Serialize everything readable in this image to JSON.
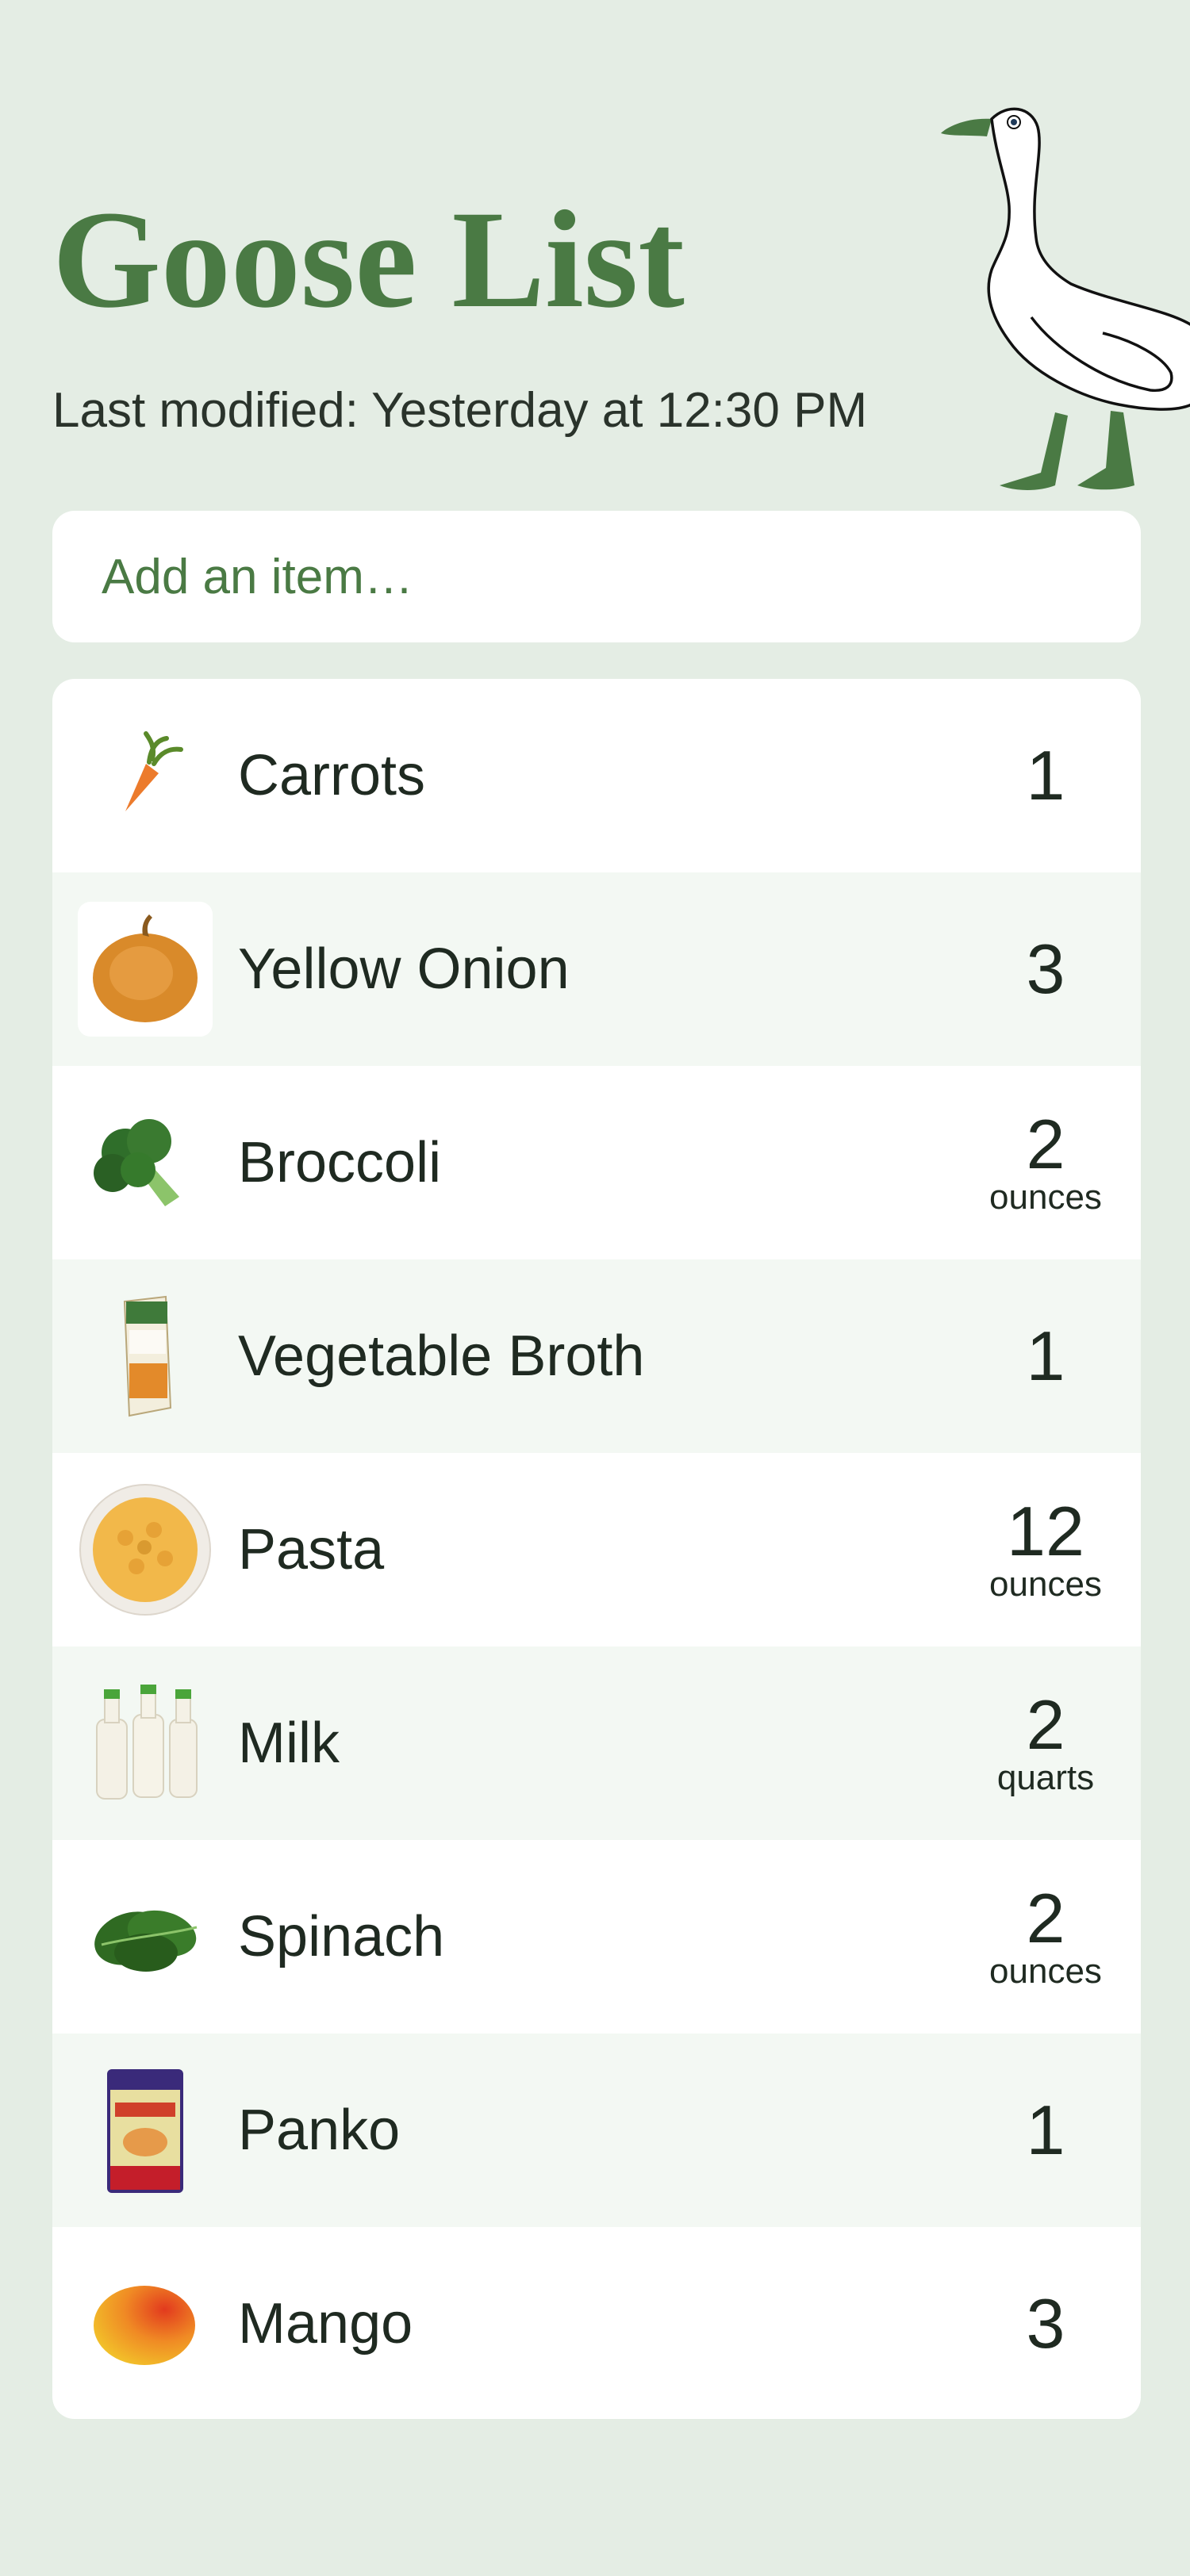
{
  "header": {
    "title": "Goose List",
    "last_modified": "Last modified: Yesterday at 12:30 PM"
  },
  "add_item": {
    "placeholder": "Add an item…"
  },
  "items": [
    {
      "name": "Carrots",
      "quantity": "1",
      "unit": "",
      "icon": "carrot-icon"
    },
    {
      "name": "Yellow Onion",
      "quantity": "3",
      "unit": "",
      "icon": "onion-icon"
    },
    {
      "name": "Broccoli",
      "quantity": "2",
      "unit": "ounces",
      "icon": "broccoli-icon"
    },
    {
      "name": "Vegetable Broth",
      "quantity": "1",
      "unit": "",
      "icon": "broth-carton-icon"
    },
    {
      "name": "Pasta",
      "quantity": "12",
      "unit": "ounces",
      "icon": "pasta-bowl-icon"
    },
    {
      "name": "Milk",
      "quantity": "2",
      "unit": "quarts",
      "icon": "milk-bottles-icon"
    },
    {
      "name": "Spinach",
      "quantity": "2",
      "unit": "ounces",
      "icon": "spinach-icon"
    },
    {
      "name": "Panko",
      "quantity": "1",
      "unit": "",
      "icon": "panko-bag-icon"
    },
    {
      "name": "Mango",
      "quantity": "3",
      "unit": "",
      "icon": "mango-icon"
    }
  ],
  "colors": {
    "background": "#e4ede4",
    "accent": "#4a7a44",
    "row_alt": "#f3f8f3",
    "card": "#ffffff"
  }
}
